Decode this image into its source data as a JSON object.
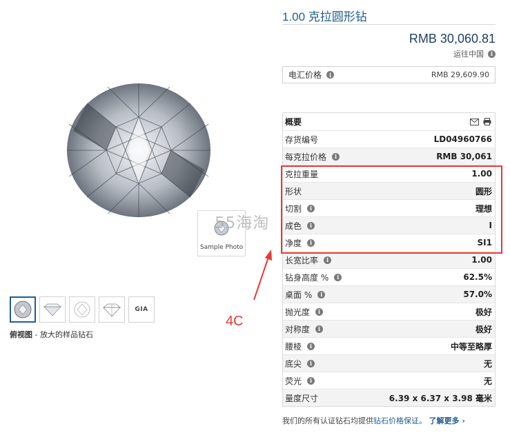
{
  "product": {
    "title": "1.00 克拉圆形钻",
    "price": "RMB 30,060.81",
    "ship_text": "运往中国",
    "wire_label": "电汇价格",
    "wire_price": "RMB 29,609.90"
  },
  "gallery": {
    "sample_label": "Sample Photo",
    "caption_bold": "俯视图",
    "caption_rest": " - 放大的样品钻石",
    "thumbnails": [
      {
        "name": "top-view"
      },
      {
        "name": "side-view"
      },
      {
        "name": "facet-diagram"
      },
      {
        "name": "profile-diagram"
      },
      {
        "name": "gia-cert",
        "text": "GIA"
      }
    ]
  },
  "watermark": "55海淘",
  "annotation": "4C",
  "overview": {
    "heading": "概要",
    "rows": [
      {
        "key": "存货编号",
        "value": "LD04960766",
        "info": false
      },
      {
        "key": "每克拉价格",
        "value": "RMB 30,061",
        "info": true
      },
      {
        "key": "克拉重量",
        "value": "1.00",
        "info": false
      },
      {
        "key": "形状",
        "value": "圆形",
        "info": false
      },
      {
        "key": "切割",
        "value": "理想",
        "info": true
      },
      {
        "key": "成色",
        "value": "I",
        "info": true
      },
      {
        "key": "净度",
        "value": "SI1",
        "info": true
      },
      {
        "key": "长宽比率",
        "value": "1.00",
        "info": true
      },
      {
        "key": "钻身高度 %",
        "value": "62.5%",
        "info": true
      },
      {
        "key": "桌面 %",
        "value": "57.0%",
        "info": true
      },
      {
        "key": "抛光度",
        "value": "极好",
        "info": true
      },
      {
        "key": "对称度",
        "value": "极好",
        "info": true
      },
      {
        "key": "腰棱",
        "value": "中等至略厚",
        "info": true
      },
      {
        "key": "底尖",
        "value": "无",
        "info": true
      },
      {
        "key": "荧光",
        "value": "无",
        "info": true
      },
      {
        "key": "量度尺寸",
        "value": "6.39 x 6.37 x 3.98 毫米",
        "info": false
      }
    ]
  },
  "footer": {
    "text": "我们的所有认证钻石均提供",
    "link": "钻石价格保证。",
    "more": "了解更多 ›"
  },
  "colors": {
    "accent": "#1f5d8f",
    "highlight": "#e53935"
  }
}
